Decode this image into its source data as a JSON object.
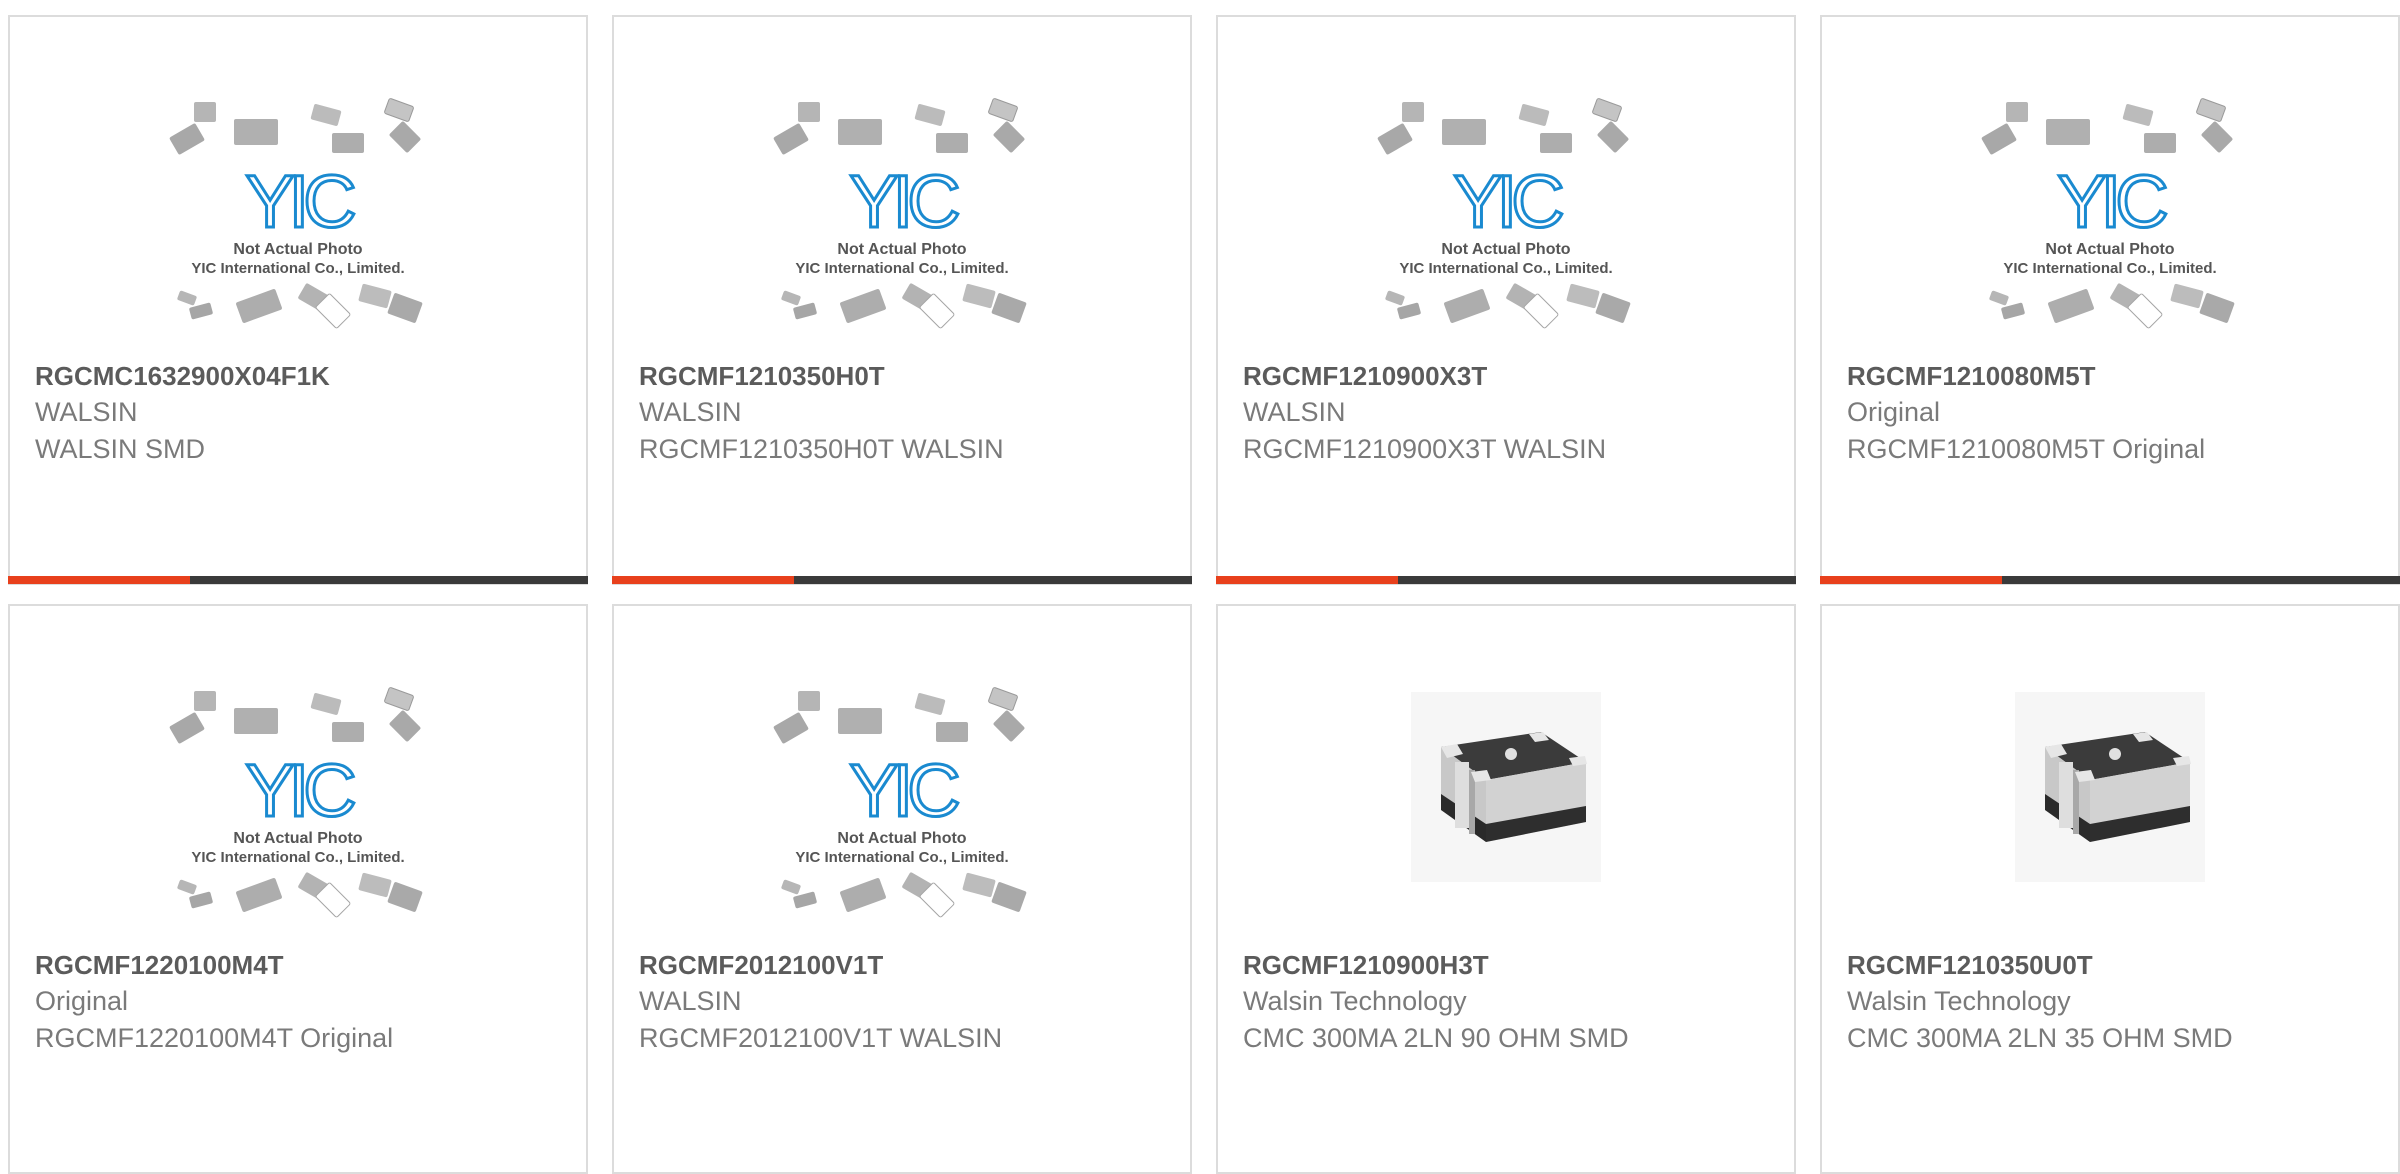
{
  "colors": {
    "accent": "#e8401c",
    "bar": "#3a3a3a",
    "logo": "#1a8ad0",
    "title_text": "#5b5b5b",
    "body_text": "#7a7a7a"
  },
  "placeholder": {
    "logo_text": "YIC",
    "line1": "Not Actual Photo",
    "line2": "YIC International Co., Limited."
  },
  "products": [
    {
      "part_number": "RGCMC1632900X04F1K",
      "manufacturer": "WALSIN",
      "description": "WALSIN SMD",
      "image": "placeholder",
      "show_bar": true
    },
    {
      "part_number": "RGCMF1210350H0T",
      "manufacturer": "WALSIN",
      "description": "RGCMF1210350H0T WALSIN",
      "image": "placeholder",
      "show_bar": true
    },
    {
      "part_number": "RGCMF1210900X3T",
      "manufacturer": "WALSIN",
      "description": "RGCMF1210900X3T WALSIN",
      "image": "placeholder",
      "show_bar": true
    },
    {
      "part_number": "RGCMF1210080M5T",
      "manufacturer": "Original",
      "description": "RGCMF1210080M5T Original",
      "image": "placeholder",
      "show_bar": true
    },
    {
      "part_number": "RGCMF1220100M4T",
      "manufacturer": "Original",
      "description": "RGCMF1220100M4T Original",
      "image": "placeholder",
      "show_bar": false
    },
    {
      "part_number": "RGCMF2012100V1T",
      "manufacturer": "WALSIN",
      "description": "RGCMF2012100V1T WALSIN",
      "image": "placeholder",
      "show_bar": false
    },
    {
      "part_number": "RGCMF1210900H3T",
      "manufacturer": "Walsin Technology",
      "description": "CMC 300MA 2LN 90 OHM SMD",
      "image": "smd-component",
      "show_bar": false
    },
    {
      "part_number": "RGCMF1210350U0T",
      "manufacturer": "Walsin Technology",
      "description": "CMC 300MA 2LN 35 OHM SMD",
      "image": "smd-component",
      "show_bar": false
    }
  ]
}
